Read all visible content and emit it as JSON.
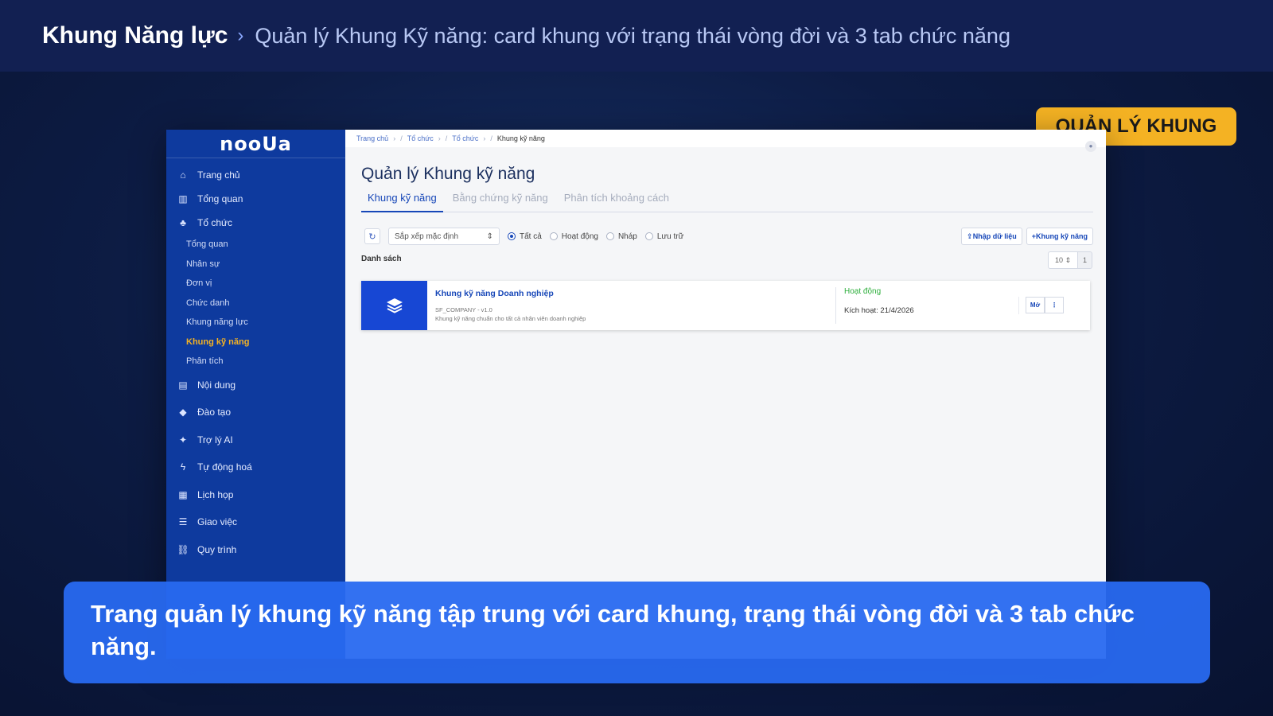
{
  "header": {
    "title": "Khung Năng lực",
    "separator": "›",
    "subtitle": "Quản lý Khung Kỹ năng: card khung với trạng thái vòng đời và 3 tab chức năng"
  },
  "badge": "QUẢN LÝ KHUNG",
  "app": {
    "logo": "nooUa",
    "breadcrumb": [
      "Trang chủ",
      "Tổ chức",
      "Tổ chức",
      "Khung kỹ năng"
    ],
    "sidebar": {
      "items": [
        {
          "icon": "home-icon",
          "glyph": "⌂",
          "label": "Trang chủ"
        },
        {
          "icon": "chart-icon",
          "glyph": "▥",
          "label": "Tổng quan"
        },
        {
          "icon": "org-icon",
          "glyph": "♣",
          "label": "Tổ chức"
        }
      ],
      "sub_items": [
        "Tổng quan",
        "Nhân sự",
        "Đơn vị",
        "Chức danh",
        "Khung năng lực",
        "Khung kỹ năng",
        "Phân tích"
      ],
      "active_sub": "Khung kỹ năng",
      "items_after": [
        {
          "icon": "book-icon",
          "glyph": "▤",
          "label": "Nội dung"
        },
        {
          "icon": "graduation-icon",
          "glyph": "◆",
          "label": "Đào tạo"
        },
        {
          "icon": "sparkle-icon",
          "glyph": "✦",
          "label": "Trợ lý AI"
        },
        {
          "icon": "bolt-icon",
          "glyph": "ϟ",
          "label": "Tự động hoá"
        },
        {
          "icon": "calendar-icon",
          "glyph": "▦",
          "label": "Lịch họp"
        },
        {
          "icon": "task-icon",
          "glyph": "☰",
          "label": "Giao việc"
        },
        {
          "icon": "workflow-icon",
          "glyph": "⛓",
          "label": "Quy trình"
        }
      ]
    },
    "page_title": "Quản lý Khung kỹ năng",
    "tabs": [
      "Khung kỹ năng",
      "Bằng chứng kỹ năng",
      "Phân tích khoảng cách"
    ],
    "active_tab": 0,
    "toolbar": {
      "sort_value": "Sắp xếp mặc định",
      "filters": [
        "Tất cả",
        "Hoạt động",
        "Nháp",
        "Lưu trữ"
      ],
      "selected_filter": 0,
      "import_label": "Nhập dữ liệu",
      "add_label": "Khung kỹ năng"
    },
    "list_label": "Danh sách",
    "page_size": "10",
    "page_number": "1",
    "card": {
      "name": "Khung kỹ năng Doanh nghiệp",
      "meta": "SF_COMPANY - v1.0",
      "description": "Khung kỹ năng chuẩn cho tất cả nhân viên doanh nghiệp",
      "status": "Hoạt động",
      "activated": "Kích hoạt: 21/4/2026",
      "open_label": "Mở",
      "more_label": "⋮",
      "status_color": "#2cae3b"
    }
  },
  "caption": "Trang quản lý khung kỹ năng tập trung với card khung, trạng thái vòng đời và 3 tab chức năng.",
  "colors": {
    "accent": "#1747b8",
    "sidebar": "#0e3a9e",
    "badge": "#f4b223",
    "caption": "#2869f0"
  }
}
